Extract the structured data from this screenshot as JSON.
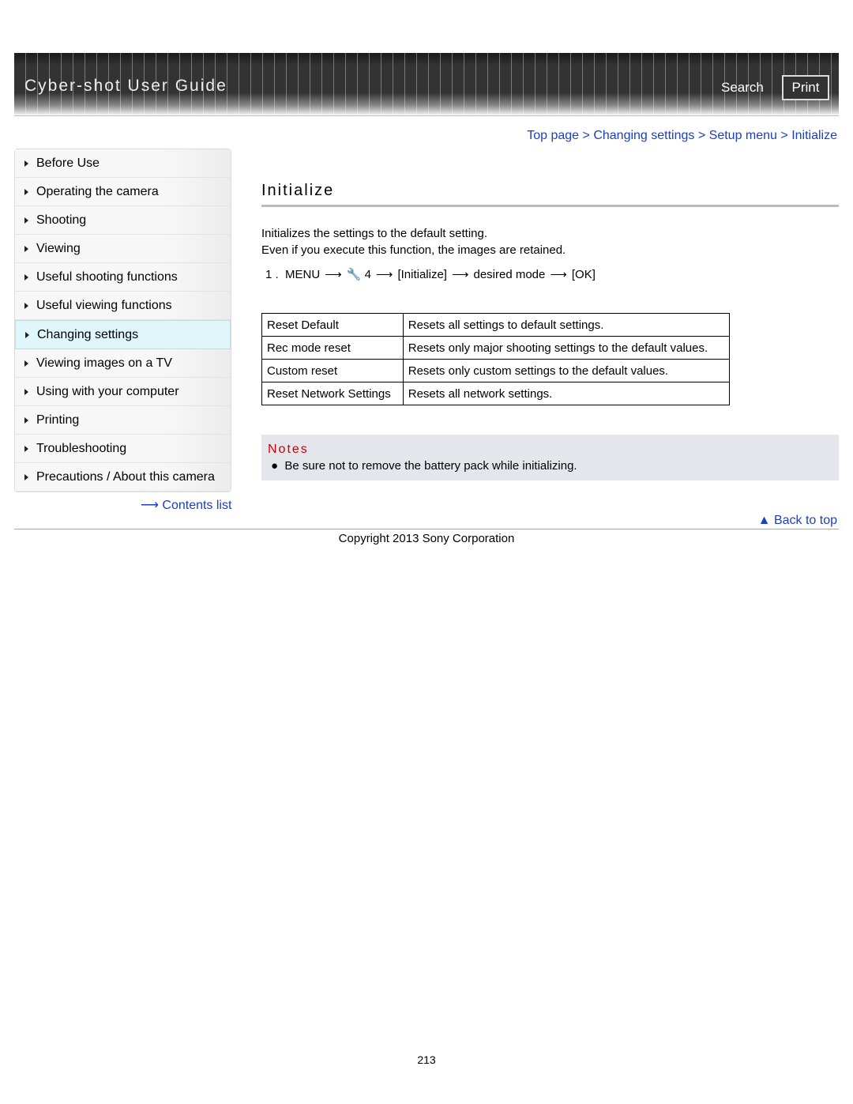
{
  "header": {
    "title": "Cyber-shot User Guide",
    "search": "Search",
    "print": "Print"
  },
  "breadcrumb": [
    "Top page",
    "Changing settings",
    "Setup menu",
    "Initialize"
  ],
  "sidebar": {
    "items": [
      "Before Use",
      "Operating the camera",
      "Shooting",
      "Viewing",
      "Useful shooting functions",
      "Useful viewing functions",
      "Changing settings",
      "Viewing images on a TV",
      "Using with your computer",
      "Printing",
      "Troubleshooting",
      "Precautions / About this camera"
    ],
    "active": "Changing settings",
    "contents_link": "Contents list"
  },
  "main": {
    "title": "Initialize",
    "desc1": "Initializes the settings to the default setting.",
    "desc2": "Even if you execute this function, the images are retained.",
    "step": {
      "num": "1 .",
      "menu": "MENU",
      "icon": "wrench-icon",
      "setup_num": "4",
      "item": "[Initialize]",
      "mode": "desired mode",
      "ok": "[OK]"
    },
    "table": [
      [
        "Reset Default",
        "Resets all settings to default settings."
      ],
      [
        "Rec mode reset",
        "Resets only major shooting settings to the default values."
      ],
      [
        "Custom reset",
        "Resets only custom settings to the default values."
      ],
      [
        "Reset Network Settings",
        "Resets all network settings."
      ]
    ],
    "notes": {
      "title": "Notes",
      "items": [
        "Be sure not to remove the battery pack while initializing."
      ]
    }
  },
  "footer": {
    "back_to_top": "Back to top",
    "copyright": "Copyright 2013 Sony Corporation",
    "page": "213"
  },
  "colors": {
    "link": "#1a3fc7",
    "notes_title": "#cc0000",
    "notes_bg": "#e4e6eb"
  }
}
